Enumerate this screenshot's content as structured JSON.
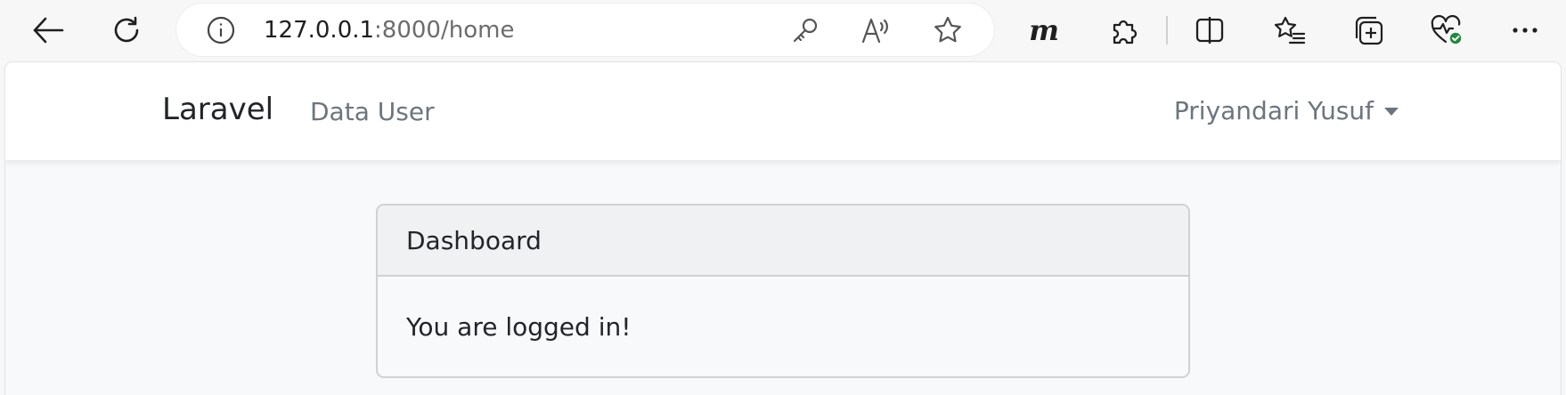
{
  "browser": {
    "url_host": "127.0.0.1",
    "url_path": ":8000/home",
    "toolbar_m_label": "m"
  },
  "navbar": {
    "brand": "Laravel",
    "links": [
      "Data User"
    ],
    "user_name": "Priyandari Yusuf"
  },
  "card": {
    "header": "Dashboard",
    "body": "You are logged in!"
  }
}
